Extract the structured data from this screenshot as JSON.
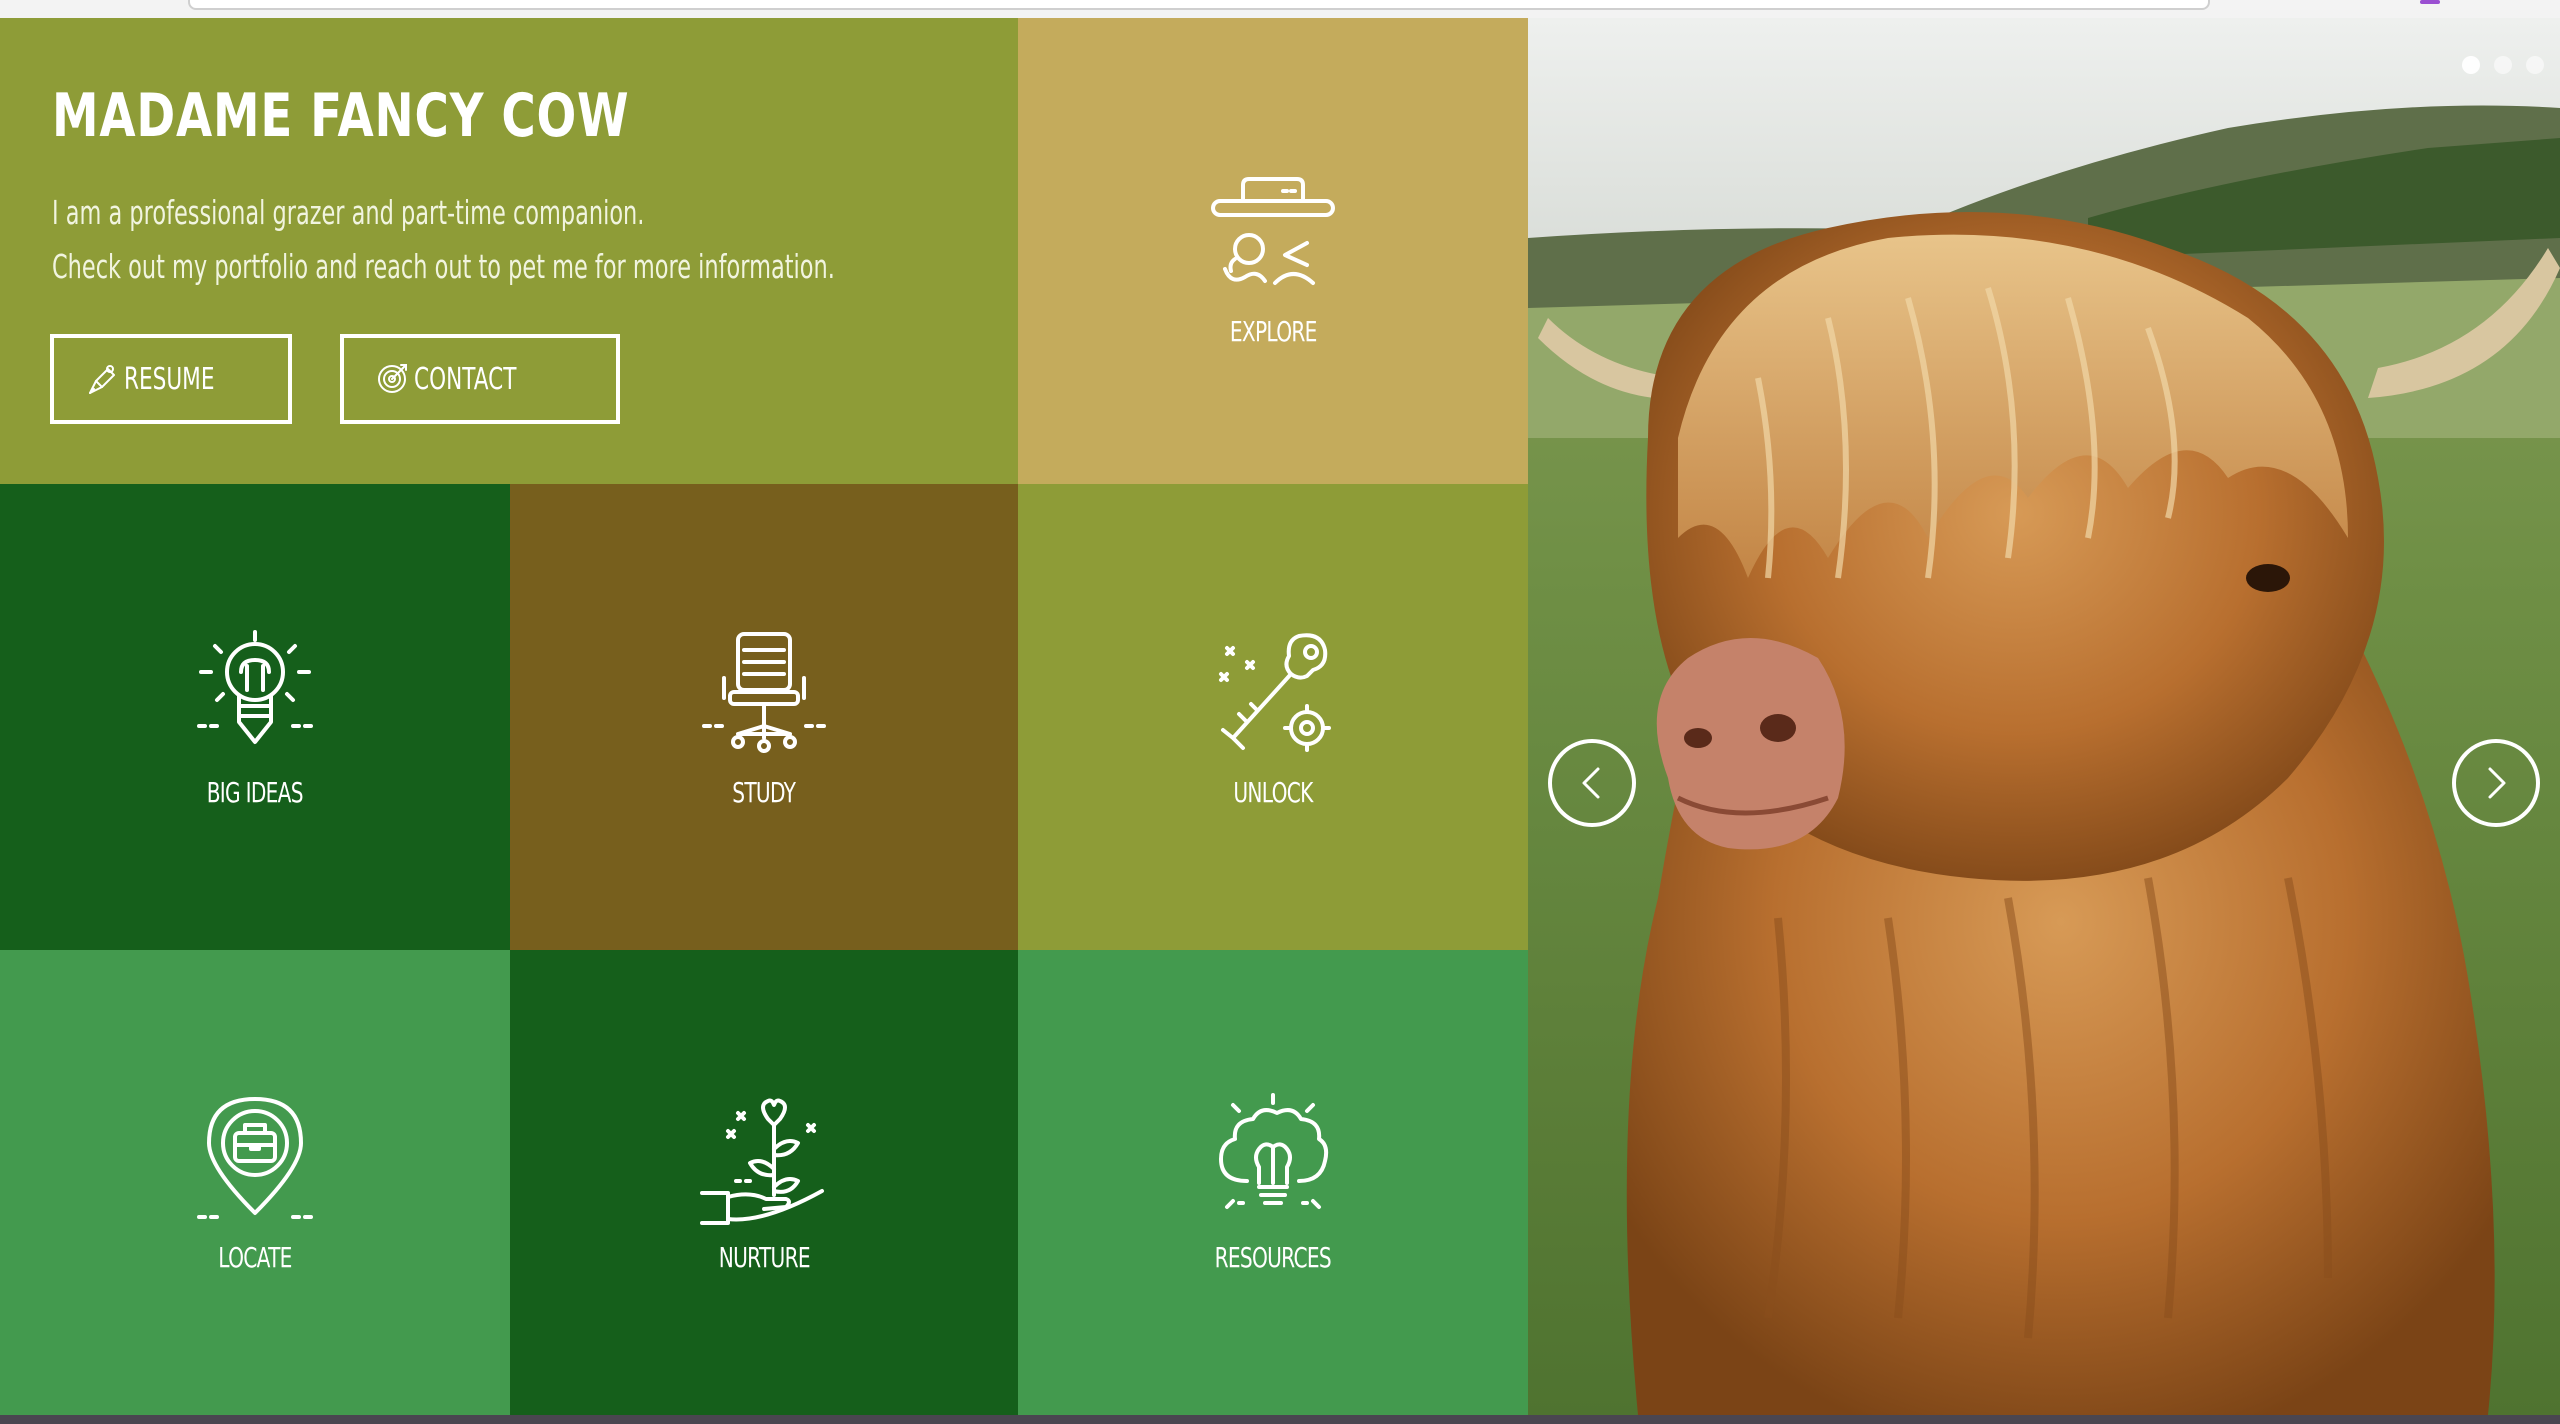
{
  "site": {
    "title": "MADAME FANCY COW",
    "tagline_lines": [
      "I am a professional grazer and part-time companion.",
      "Check out my portfolio and reach out to pet me for more information."
    ],
    "buttons": [
      {
        "label": "RESUME",
        "icon": "pen-icon"
      },
      {
        "label": "CONTACT",
        "icon": "target-icon"
      }
    ]
  },
  "tiles": [
    {
      "label": "EXPLORE",
      "icon": "hat-disguise-icon",
      "color": "#c4ab5c"
    },
    {
      "label": "BIG IDEAS",
      "icon": "lightbulb-pencil-icon",
      "color": "#155f1b"
    },
    {
      "label": "STUDY",
      "icon": "office-chair-icon",
      "color": "#775f1d"
    },
    {
      "label": "UNLOCK",
      "icon": "key-gear-icon",
      "color": "#8e9c37"
    },
    {
      "label": "LOCATE",
      "icon": "map-pin-briefcase-icon",
      "color": "#439a4e"
    },
    {
      "label": "NURTURE",
      "icon": "hand-plant-heart-icon",
      "color": "#155f1b"
    },
    {
      "label": "RESOURCES",
      "icon": "brain-lightbulb-icon",
      "color": "#439a4e"
    }
  ],
  "colors": {
    "intro_bg": "#8e9c37",
    "white": "#ffffff"
  },
  "carousel": {
    "prev_icon": "chevron-left-icon",
    "next_icon": "chevron-right-icon",
    "slide_count": 3,
    "active_slide": 1
  }
}
